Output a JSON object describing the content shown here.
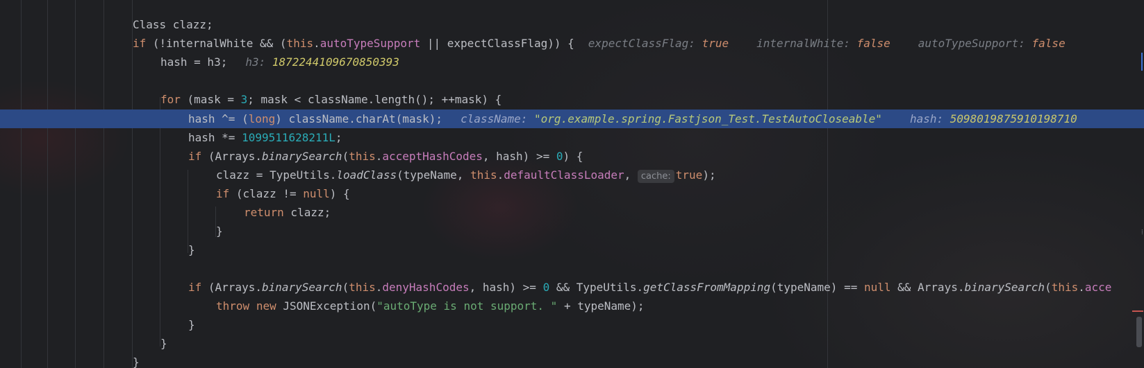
{
  "editor": {
    "lines": [
      {
        "id": "l1",
        "parts": [
          {
            "t": "Class clazz;"
          }
        ]
      },
      {
        "id": "l2",
        "parts": [
          {
            "t": "if",
            "c": "kw"
          },
          {
            "t": " (!internalWhite && ("
          },
          {
            "t": "this",
            "c": "kw"
          },
          {
            "t": "."
          },
          {
            "t": "autoTypeSupport",
            "c": "field"
          },
          {
            "t": " || expectClassFlag)) {"
          }
        ]
      },
      {
        "id": "l3",
        "parts": [
          {
            "t": "hash = h3;"
          }
        ]
      },
      {
        "id": "l4",
        "parts": []
      },
      {
        "id": "l5",
        "parts": [
          {
            "t": "for",
            "c": "kw"
          },
          {
            "t": " (mask = "
          },
          {
            "t": "3",
            "c": "num"
          },
          {
            "t": "; mask < className.length(); ++mask) {"
          }
        ]
      },
      {
        "id": "l6",
        "parts": [
          {
            "t": "hash ^= ("
          },
          {
            "t": "long",
            "c": "kw"
          },
          {
            "t": ") className.charAt(mask);"
          }
        ]
      },
      {
        "id": "l7",
        "parts": [
          {
            "t": "hash *= "
          },
          {
            "t": "1099511628211L",
            "c": "num"
          },
          {
            "t": ";"
          }
        ]
      },
      {
        "id": "l8",
        "parts": [
          {
            "t": "if",
            "c": "kw"
          },
          {
            "t": " (Arrays."
          },
          {
            "t": "binarySearch",
            "c": "it"
          },
          {
            "t": "("
          },
          {
            "t": "this",
            "c": "kw"
          },
          {
            "t": "."
          },
          {
            "t": "acceptHashCodes",
            "c": "field"
          },
          {
            "t": ", hash) >= "
          },
          {
            "t": "0",
            "c": "num"
          },
          {
            "t": ") {"
          }
        ]
      },
      {
        "id": "l9",
        "parts": [
          {
            "t": "clazz = TypeUtils."
          },
          {
            "t": "loadClass",
            "c": "it"
          },
          {
            "t": "(typeName, "
          },
          {
            "t": "this",
            "c": "kw"
          },
          {
            "t": "."
          },
          {
            "t": "defaultClassLoader",
            "c": "field"
          },
          {
            "t": ", "
          },
          {
            "hint": "cache:"
          },
          {
            "t": "true",
            "c": "kw"
          },
          {
            "t": ");"
          }
        ]
      },
      {
        "id": "l10",
        "parts": [
          {
            "t": "if",
            "c": "kw"
          },
          {
            "t": " (clazz != "
          },
          {
            "t": "null",
            "c": "kw"
          },
          {
            "t": ") {"
          }
        ]
      },
      {
        "id": "l11",
        "parts": [
          {
            "t": "return",
            "c": "kw"
          },
          {
            "t": " clazz;"
          }
        ]
      },
      {
        "id": "l12",
        "parts": [
          {
            "t": "}"
          }
        ]
      },
      {
        "id": "l13",
        "parts": [
          {
            "t": "}"
          }
        ]
      },
      {
        "id": "l14",
        "parts": []
      },
      {
        "id": "l15",
        "parts": [
          {
            "t": "if",
            "c": "kw"
          },
          {
            "t": " (Arrays."
          },
          {
            "t": "binarySearch",
            "c": "it"
          },
          {
            "t": "("
          },
          {
            "t": "this",
            "c": "kw"
          },
          {
            "t": "."
          },
          {
            "t": "denyHashCodes",
            "c": "field"
          },
          {
            "t": ", hash) >= "
          },
          {
            "t": "0",
            "c": "num"
          },
          {
            "t": " && TypeUtils."
          },
          {
            "t": "getClassFromMapping",
            "c": "it"
          },
          {
            "t": "(typeName) == "
          },
          {
            "t": "null",
            "c": "kw"
          },
          {
            "t": " && Arrays."
          },
          {
            "t": "binarySearch",
            "c": "it"
          },
          {
            "t": "("
          },
          {
            "t": "this",
            "c": "kw"
          },
          {
            "t": "."
          },
          {
            "t": "acce",
            "c": "field"
          }
        ]
      },
      {
        "id": "l16",
        "parts": [
          {
            "t": "throw",
            "c": "kw"
          },
          {
            "t": " "
          },
          {
            "t": "new",
            "c": "kw"
          },
          {
            "t": " JSONException("
          },
          {
            "t": "\"autoType is not support. \"",
            "c": "str"
          },
          {
            "t": " + typeName);"
          }
        ]
      },
      {
        "id": "l17",
        "parts": [
          {
            "t": "}"
          }
        ]
      },
      {
        "id": "l18",
        "parts": [
          {
            "t": "}"
          }
        ]
      },
      {
        "id": "l19",
        "parts": [
          {
            "t": "}"
          }
        ]
      }
    ],
    "inlay_hints": {
      "l2": [
        {
          "label": "expectClassFlag:",
          "value": "true",
          "kind": "bool"
        },
        {
          "label": "internalWhite:",
          "value": "false",
          "kind": "bool"
        },
        {
          "label": "autoTypeSupport:",
          "value": "false",
          "kind": "bool"
        }
      ],
      "l3": [
        {
          "label": "h3:",
          "value": "1872244109670850393",
          "kind": "num"
        }
      ],
      "l6": [
        {
          "label": "className:",
          "value": "\"org.example.spring.Fastjson_Test.TestAutoCloseable\"",
          "kind": "str"
        },
        {
          "label": "hash:",
          "value": "5098019875910198710",
          "kind": "num"
        }
      ]
    }
  },
  "colors": {
    "background": "#1f2023",
    "current_line_highlight": "#2c4a86",
    "keyword": "#cf8e6d",
    "field": "#c77dbb",
    "number": "#2aacb8",
    "string": "#6aab73"
  }
}
